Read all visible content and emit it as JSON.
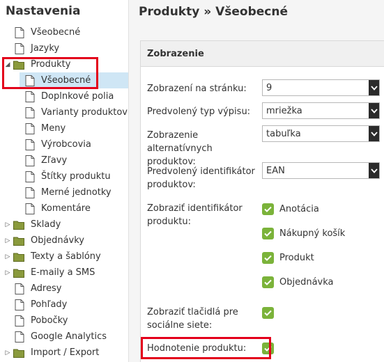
{
  "sidebar": {
    "title": "Nastavenia",
    "items": [
      {
        "label": "Všeobecné",
        "type": "page"
      },
      {
        "label": "Jazyky",
        "type": "page"
      },
      {
        "label": "Produkty",
        "type": "folder-open"
      },
      {
        "label": "Všeobecné",
        "type": "page",
        "selected": true
      },
      {
        "label": "Doplnkové polia",
        "type": "page"
      },
      {
        "label": "Varianty produktov",
        "type": "page"
      },
      {
        "label": "Meny",
        "type": "page"
      },
      {
        "label": "Výrobcovia",
        "type": "page"
      },
      {
        "label": "Zľavy",
        "type": "page"
      },
      {
        "label": "Štítky produktu",
        "type": "page"
      },
      {
        "label": "Merné jednotky",
        "type": "page"
      },
      {
        "label": "Komentáre",
        "type": "page"
      },
      {
        "label": "Sklady",
        "type": "folder"
      },
      {
        "label": "Objednávky",
        "type": "folder"
      },
      {
        "label": "Texty a šablóny",
        "type": "folder"
      },
      {
        "label": "E-maily a SMS",
        "type": "folder"
      },
      {
        "label": "Adresy",
        "type": "page"
      },
      {
        "label": "Pohľady",
        "type": "page"
      },
      {
        "label": "Pobočky",
        "type": "page"
      },
      {
        "label": "Google Analytics",
        "type": "page"
      },
      {
        "label": "Import / Export",
        "type": "folder"
      }
    ]
  },
  "main": {
    "title": "Produkty » Všeobecné",
    "panel_title": "Zobrazenie",
    "fields": {
      "per_page_label": "Zobrazení na stránku:",
      "per_page_value": "9",
      "list_type_label": "Predvolený typ výpisu:",
      "list_type_value": "mriežka",
      "alt_products_label": "Zobrazenie alternatívnych produktov:",
      "alt_products_value": "tabuľka",
      "identifier_label": "Predvolený identifikátor produktov:",
      "identifier_value": "EAN",
      "show_identifier_label": "Zobraziť identifikátor produktu:",
      "show_identifier_options": [
        "Anotácia",
        "Nákupný košík",
        "Produkt",
        "Objednávka"
      ],
      "social_label": "Zobraziť tlačidlá pre sociálne siete:",
      "rating_label": "Hodnotenie produktu:"
    }
  },
  "colors": {
    "checkbox": "#7bb33a",
    "highlight": "#e3001b",
    "selected_bg": "#cfe6f5",
    "folder": "#8a9a3c"
  }
}
